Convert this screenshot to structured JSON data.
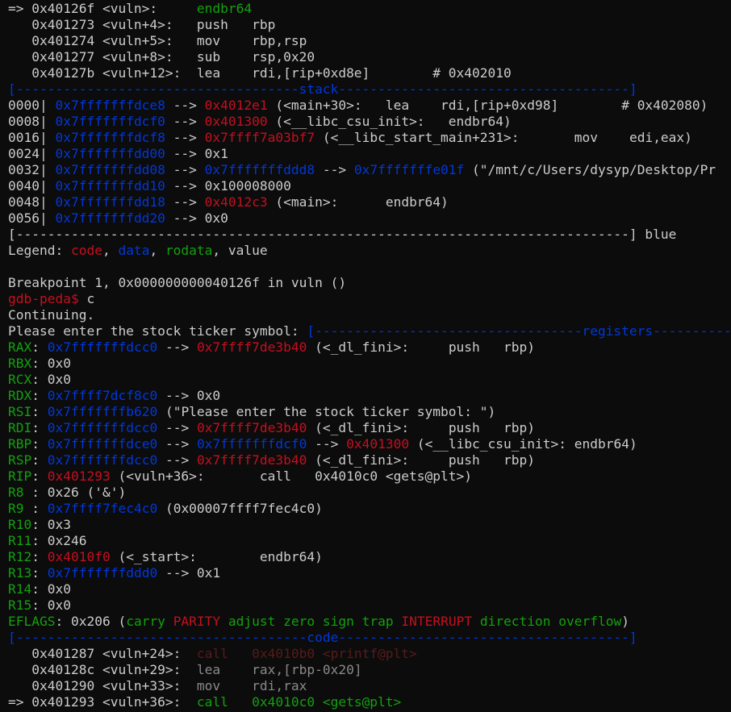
{
  "palette": {
    "default": "#cccccc",
    "green": "#13a10e",
    "blue": "#0037da",
    "red": "#c50f1f",
    "darkred": "#5a1a1a",
    "grey": "#8a8a8a",
    "background": "#0c0c0c"
  },
  "lines": [
    {
      "name": "disasm-current-line",
      "segs": [
        [
          "default",
          "=> 0x40126f <vuln>:     "
        ],
        [
          "green",
          "endbr64"
        ]
      ]
    },
    {
      "name": "disasm-line",
      "segs": [
        [
          "default",
          "   0x401273 <vuln+4>:   push   rbp"
        ]
      ]
    },
    {
      "name": "disasm-line",
      "segs": [
        [
          "default",
          "   0x401274 <vuln+5>:   mov    rbp,rsp"
        ]
      ]
    },
    {
      "name": "disasm-line",
      "segs": [
        [
          "default",
          "   0x401277 <vuln+8>:   sub    rsp,0x20"
        ]
      ]
    },
    {
      "name": "disasm-line",
      "segs": [
        [
          "default",
          "   0x40127b <vuln+12>:  lea    rdi,[rip+0xd8e]        # 0x402010"
        ]
      ]
    },
    {
      "name": "stack-section-header",
      "segs": [
        [
          "blue",
          "[------------------------------------stack-------------------------------------]"
        ]
      ]
    },
    {
      "name": "stack-row",
      "segs": [
        [
          "default",
          "0000| "
        ],
        [
          "blue",
          "0x7fffffffdce8"
        ],
        [
          "default",
          " --> "
        ],
        [
          "red",
          "0x4012e1"
        ],
        [
          "default",
          " (<main+30>:   lea    rdi,[rip+0xd98]        # 0x402080)"
        ]
      ]
    },
    {
      "name": "stack-row",
      "segs": [
        [
          "default",
          "0008| "
        ],
        [
          "blue",
          "0x7fffffffdcf0"
        ],
        [
          "default",
          " --> "
        ],
        [
          "red",
          "0x401300"
        ],
        [
          "default",
          " (<__libc_csu_init>:   endbr64)"
        ]
      ]
    },
    {
      "name": "stack-row",
      "segs": [
        [
          "default",
          "0016| "
        ],
        [
          "blue",
          "0x7fffffffdcf8"
        ],
        [
          "default",
          " --> "
        ],
        [
          "red",
          "0x7ffff7a03bf7"
        ],
        [
          "default",
          " (<__libc_start_main+231>:       mov    edi,eax)"
        ]
      ]
    },
    {
      "name": "stack-row",
      "segs": [
        [
          "default",
          "0024| "
        ],
        [
          "blue",
          "0x7fffffffdd00"
        ],
        [
          "default",
          " --> 0x1"
        ]
      ]
    },
    {
      "name": "stack-row",
      "segs": [
        [
          "default",
          "0032| "
        ],
        [
          "blue",
          "0x7fffffffdd08"
        ],
        [
          "default",
          " --> "
        ],
        [
          "blue",
          "0x7fffffffddd8"
        ],
        [
          "default",
          " --> "
        ],
        [
          "blue",
          "0x7fffffffe01f"
        ],
        [
          "default",
          " (\"/mnt/c/Users/dysyp/Desktop/Pr"
        ]
      ]
    },
    {
      "name": "stack-row",
      "segs": [
        [
          "default",
          "0040| "
        ],
        [
          "blue",
          "0x7fffffffdd10"
        ],
        [
          "default",
          " --> 0x100008000"
        ]
      ]
    },
    {
      "name": "stack-row",
      "segs": [
        [
          "default",
          "0048| "
        ],
        [
          "blue",
          "0x7fffffffdd18"
        ],
        [
          "default",
          " --> "
        ],
        [
          "red",
          "0x4012c3"
        ],
        [
          "default",
          " (<main>:      endbr64)"
        ]
      ]
    },
    {
      "name": "stack-row",
      "segs": [
        [
          "default",
          "0056| "
        ],
        [
          "blue",
          "0x7fffffffdd20"
        ],
        [
          "default",
          " --> 0x0"
        ]
      ]
    },
    {
      "name": "section-footer",
      "segs": [
        [
          "default",
          "[------------------------------------------------------------------------------] blue"
        ]
      ]
    },
    {
      "name": "legend-line",
      "segs": [
        [
          "default",
          "Legend: "
        ],
        [
          "red",
          "code"
        ],
        [
          "default",
          ", "
        ],
        [
          "blue",
          "data"
        ],
        [
          "default",
          ", "
        ],
        [
          "green",
          "rodata"
        ],
        [
          "default",
          ", value"
        ]
      ]
    },
    {
      "name": "blank-line",
      "segs": [
        [
          "default",
          ""
        ]
      ]
    },
    {
      "name": "breakpoint-message",
      "segs": [
        [
          "default",
          "Breakpoint 1, 0x000000000040126f in vuln ()"
        ]
      ]
    },
    {
      "name": "gdb-prompt",
      "segs": [
        [
          "red",
          "gdb-peda$"
        ],
        [
          "default",
          " c"
        ]
      ]
    },
    {
      "name": "output-line",
      "segs": [
        [
          "default",
          "Continuing."
        ]
      ]
    },
    {
      "name": "program-prompt-line",
      "segs": [
        [
          "default",
          "Please enter the stock ticker symbol: "
        ],
        [
          "blue",
          "[----------------------------------registers-----------------------------------]"
        ]
      ]
    },
    {
      "name": "register-rax",
      "segs": [
        [
          "green",
          "RAX"
        ],
        [
          "default",
          ": "
        ],
        [
          "blue",
          "0x7fffffffdcc0"
        ],
        [
          "default",
          " --> "
        ],
        [
          "red",
          "0x7ffff7de3b40"
        ],
        [
          "default",
          " (<_dl_fini>:     push   rbp)"
        ]
      ]
    },
    {
      "name": "register-rbx",
      "segs": [
        [
          "green",
          "RBX"
        ],
        [
          "default",
          ": 0x0"
        ]
      ]
    },
    {
      "name": "register-rcx",
      "segs": [
        [
          "green",
          "RCX"
        ],
        [
          "default",
          ": 0x0"
        ]
      ]
    },
    {
      "name": "register-rdx",
      "segs": [
        [
          "green",
          "RDX"
        ],
        [
          "default",
          ": "
        ],
        [
          "blue",
          "0x7ffff7dcf8c0"
        ],
        [
          "default",
          " --> 0x0"
        ]
      ]
    },
    {
      "name": "register-rsi",
      "segs": [
        [
          "green",
          "RSI"
        ],
        [
          "default",
          ": "
        ],
        [
          "blue",
          "0x7fffffffb620"
        ],
        [
          "default",
          " (\"Please enter the stock ticker symbol: \")"
        ]
      ]
    },
    {
      "name": "register-rdi",
      "segs": [
        [
          "green",
          "RDI"
        ],
        [
          "default",
          ": "
        ],
        [
          "blue",
          "0x7fffffffdcc0"
        ],
        [
          "default",
          " --> "
        ],
        [
          "red",
          "0x7ffff7de3b40"
        ],
        [
          "default",
          " (<_dl_fini>:     push   rbp)"
        ]
      ]
    },
    {
      "name": "register-rbp",
      "segs": [
        [
          "green",
          "RBP"
        ],
        [
          "default",
          ": "
        ],
        [
          "blue",
          "0x7fffffffdce0"
        ],
        [
          "default",
          " --> "
        ],
        [
          "blue",
          "0x7fffffffdcf0"
        ],
        [
          "default",
          " --> "
        ],
        [
          "red",
          "0x401300"
        ],
        [
          "default",
          " (<__libc_csu_init>: endbr64)"
        ]
      ]
    },
    {
      "name": "register-rsp",
      "segs": [
        [
          "green",
          "RSP"
        ],
        [
          "default",
          ": "
        ],
        [
          "blue",
          "0x7fffffffdcc0"
        ],
        [
          "default",
          " --> "
        ],
        [
          "red",
          "0x7ffff7de3b40"
        ],
        [
          "default",
          " (<_dl_fini>:     push   rbp)"
        ]
      ]
    },
    {
      "name": "register-rip",
      "segs": [
        [
          "green",
          "RIP"
        ],
        [
          "default",
          ": "
        ],
        [
          "red",
          "0x401293"
        ],
        [
          "default",
          " (<vuln+36>:       call   0x4010c0 <gets@plt>)"
        ]
      ]
    },
    {
      "name": "register-r8",
      "segs": [
        [
          "green",
          "R8"
        ],
        [
          "default",
          " : 0x26 ('&')"
        ]
      ]
    },
    {
      "name": "register-r9",
      "segs": [
        [
          "green",
          "R9"
        ],
        [
          "default",
          " : "
        ],
        [
          "blue",
          "0x7ffff7fec4c0"
        ],
        [
          "default",
          " (0x00007ffff7fec4c0)"
        ]
      ]
    },
    {
      "name": "register-r10",
      "segs": [
        [
          "green",
          "R10"
        ],
        [
          "default",
          ": 0x3"
        ]
      ]
    },
    {
      "name": "register-r11",
      "segs": [
        [
          "green",
          "R11"
        ],
        [
          "default",
          ": 0x246"
        ]
      ]
    },
    {
      "name": "register-r12",
      "segs": [
        [
          "green",
          "R12"
        ],
        [
          "default",
          ": "
        ],
        [
          "red",
          "0x4010f0"
        ],
        [
          "default",
          " (<_start>:        endbr64)"
        ]
      ]
    },
    {
      "name": "register-r13",
      "segs": [
        [
          "green",
          "R13"
        ],
        [
          "default",
          ": "
        ],
        [
          "blue",
          "0x7fffffffddd0"
        ],
        [
          "default",
          " --> 0x1"
        ]
      ]
    },
    {
      "name": "register-r14",
      "segs": [
        [
          "green",
          "R14"
        ],
        [
          "default",
          ": 0x0"
        ]
      ]
    },
    {
      "name": "register-r15",
      "segs": [
        [
          "green",
          "R15"
        ],
        [
          "default",
          ": 0x0"
        ]
      ]
    },
    {
      "name": "register-eflags",
      "segs": [
        [
          "green",
          "EFLAGS"
        ],
        [
          "default",
          ": 0x206 ("
        ],
        [
          "green",
          "carry"
        ],
        [
          "default",
          " "
        ],
        [
          "red",
          "PARITY"
        ],
        [
          "default",
          " "
        ],
        [
          "green",
          "adjust"
        ],
        [
          "default",
          " "
        ],
        [
          "green",
          "zero"
        ],
        [
          "default",
          " "
        ],
        [
          "green",
          "sign"
        ],
        [
          "default",
          " "
        ],
        [
          "green",
          "trap"
        ],
        [
          "default",
          " "
        ],
        [
          "red",
          "INTERRUPT"
        ],
        [
          "default",
          " "
        ],
        [
          "green",
          "direction"
        ],
        [
          "default",
          " "
        ],
        [
          "green",
          "overflow"
        ],
        [
          "default",
          ")"
        ]
      ]
    },
    {
      "name": "code-section-header",
      "segs": [
        [
          "blue",
          "[-------------------------------------code-------------------------------------]"
        ]
      ]
    },
    {
      "name": "code-line-previous",
      "segs": [
        [
          "default",
          "   0x401287 <vuln+24>:  "
        ],
        [
          "darkred",
          "call   0x4010b0 <printf@plt>"
        ]
      ]
    },
    {
      "name": "code-line-previous",
      "segs": [
        [
          "default",
          "   0x40128c <vuln+29>:  "
        ],
        [
          "grey",
          "lea    rax,[rbp-0x20]"
        ]
      ]
    },
    {
      "name": "code-line-previous",
      "segs": [
        [
          "default",
          "   0x401290 <vuln+33>:  "
        ],
        [
          "grey",
          "mov    rdi,rax"
        ]
      ]
    },
    {
      "name": "code-current-line",
      "segs": [
        [
          "default",
          "=> 0x401293 <vuln+36>:  "
        ],
        [
          "green",
          "call   0x4010c0 <gets@plt>"
        ]
      ]
    }
  ]
}
